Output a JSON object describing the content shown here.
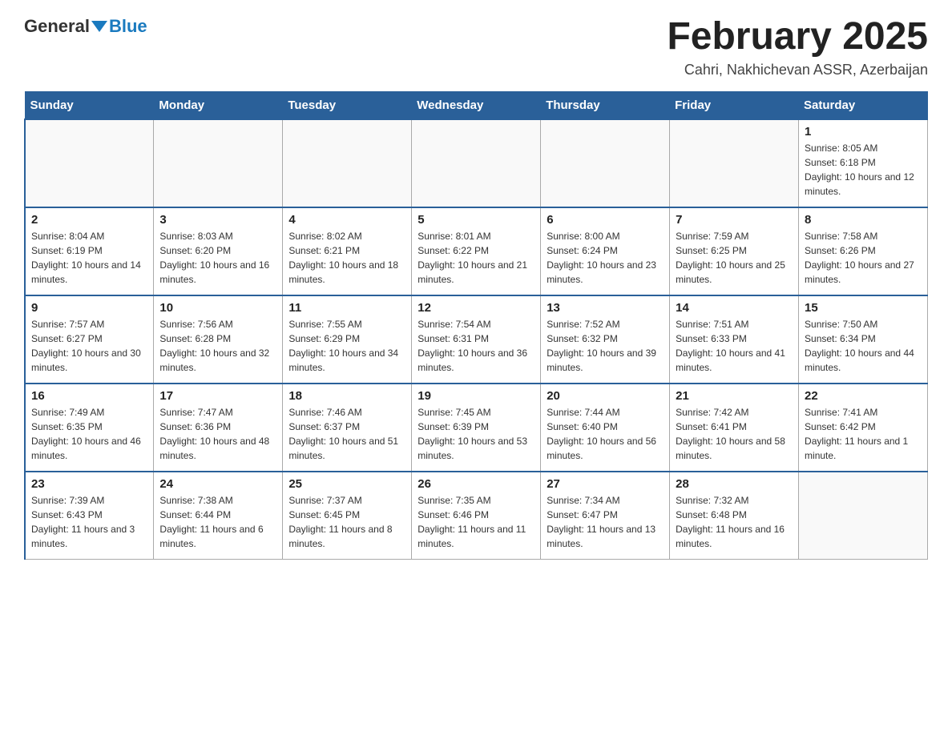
{
  "header": {
    "logo_general": "General",
    "logo_blue": "Blue",
    "month_title": "February 2025",
    "location": "Cahri, Nakhichevan ASSR, Azerbaijan"
  },
  "weekdays": [
    "Sunday",
    "Monday",
    "Tuesday",
    "Wednesday",
    "Thursday",
    "Friday",
    "Saturday"
  ],
  "weeks": [
    [
      {
        "day": "",
        "info": ""
      },
      {
        "day": "",
        "info": ""
      },
      {
        "day": "",
        "info": ""
      },
      {
        "day": "",
        "info": ""
      },
      {
        "day": "",
        "info": ""
      },
      {
        "day": "",
        "info": ""
      },
      {
        "day": "1",
        "info": "Sunrise: 8:05 AM\nSunset: 6:18 PM\nDaylight: 10 hours and 12 minutes."
      }
    ],
    [
      {
        "day": "2",
        "info": "Sunrise: 8:04 AM\nSunset: 6:19 PM\nDaylight: 10 hours and 14 minutes."
      },
      {
        "day": "3",
        "info": "Sunrise: 8:03 AM\nSunset: 6:20 PM\nDaylight: 10 hours and 16 minutes."
      },
      {
        "day": "4",
        "info": "Sunrise: 8:02 AM\nSunset: 6:21 PM\nDaylight: 10 hours and 18 minutes."
      },
      {
        "day": "5",
        "info": "Sunrise: 8:01 AM\nSunset: 6:22 PM\nDaylight: 10 hours and 21 minutes."
      },
      {
        "day": "6",
        "info": "Sunrise: 8:00 AM\nSunset: 6:24 PM\nDaylight: 10 hours and 23 minutes."
      },
      {
        "day": "7",
        "info": "Sunrise: 7:59 AM\nSunset: 6:25 PM\nDaylight: 10 hours and 25 minutes."
      },
      {
        "day": "8",
        "info": "Sunrise: 7:58 AM\nSunset: 6:26 PM\nDaylight: 10 hours and 27 minutes."
      }
    ],
    [
      {
        "day": "9",
        "info": "Sunrise: 7:57 AM\nSunset: 6:27 PM\nDaylight: 10 hours and 30 minutes."
      },
      {
        "day": "10",
        "info": "Sunrise: 7:56 AM\nSunset: 6:28 PM\nDaylight: 10 hours and 32 minutes."
      },
      {
        "day": "11",
        "info": "Sunrise: 7:55 AM\nSunset: 6:29 PM\nDaylight: 10 hours and 34 minutes."
      },
      {
        "day": "12",
        "info": "Sunrise: 7:54 AM\nSunset: 6:31 PM\nDaylight: 10 hours and 36 minutes."
      },
      {
        "day": "13",
        "info": "Sunrise: 7:52 AM\nSunset: 6:32 PM\nDaylight: 10 hours and 39 minutes."
      },
      {
        "day": "14",
        "info": "Sunrise: 7:51 AM\nSunset: 6:33 PM\nDaylight: 10 hours and 41 minutes."
      },
      {
        "day": "15",
        "info": "Sunrise: 7:50 AM\nSunset: 6:34 PM\nDaylight: 10 hours and 44 minutes."
      }
    ],
    [
      {
        "day": "16",
        "info": "Sunrise: 7:49 AM\nSunset: 6:35 PM\nDaylight: 10 hours and 46 minutes."
      },
      {
        "day": "17",
        "info": "Sunrise: 7:47 AM\nSunset: 6:36 PM\nDaylight: 10 hours and 48 minutes."
      },
      {
        "day": "18",
        "info": "Sunrise: 7:46 AM\nSunset: 6:37 PM\nDaylight: 10 hours and 51 minutes."
      },
      {
        "day": "19",
        "info": "Sunrise: 7:45 AM\nSunset: 6:39 PM\nDaylight: 10 hours and 53 minutes."
      },
      {
        "day": "20",
        "info": "Sunrise: 7:44 AM\nSunset: 6:40 PM\nDaylight: 10 hours and 56 minutes."
      },
      {
        "day": "21",
        "info": "Sunrise: 7:42 AM\nSunset: 6:41 PM\nDaylight: 10 hours and 58 minutes."
      },
      {
        "day": "22",
        "info": "Sunrise: 7:41 AM\nSunset: 6:42 PM\nDaylight: 11 hours and 1 minute."
      }
    ],
    [
      {
        "day": "23",
        "info": "Sunrise: 7:39 AM\nSunset: 6:43 PM\nDaylight: 11 hours and 3 minutes."
      },
      {
        "day": "24",
        "info": "Sunrise: 7:38 AM\nSunset: 6:44 PM\nDaylight: 11 hours and 6 minutes."
      },
      {
        "day": "25",
        "info": "Sunrise: 7:37 AM\nSunset: 6:45 PM\nDaylight: 11 hours and 8 minutes."
      },
      {
        "day": "26",
        "info": "Sunrise: 7:35 AM\nSunset: 6:46 PM\nDaylight: 11 hours and 11 minutes."
      },
      {
        "day": "27",
        "info": "Sunrise: 7:34 AM\nSunset: 6:47 PM\nDaylight: 11 hours and 13 minutes."
      },
      {
        "day": "28",
        "info": "Sunrise: 7:32 AM\nSunset: 6:48 PM\nDaylight: 11 hours and 16 minutes."
      },
      {
        "day": "",
        "info": ""
      }
    ]
  ]
}
